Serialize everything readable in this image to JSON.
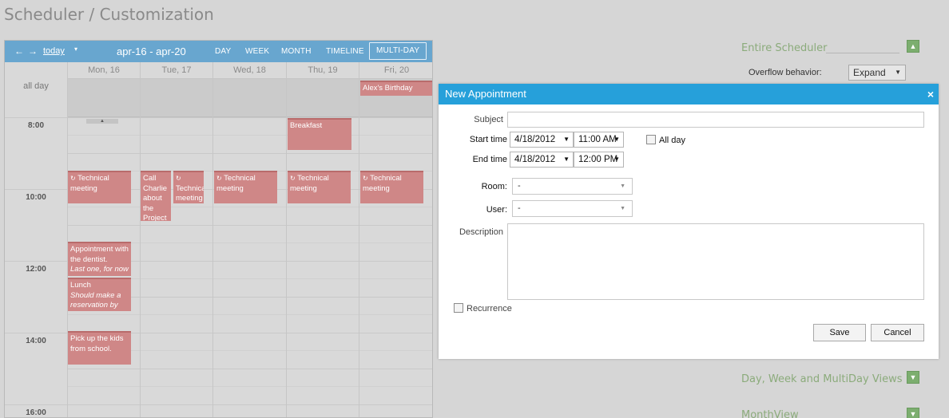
{
  "page": {
    "title": "Scheduler / Customization"
  },
  "toolbar": {
    "prev": "←",
    "next": "→",
    "today": "today",
    "today_caret": "▾",
    "range": "apr-16 - apr-20",
    "views": [
      "DAY",
      "WEEK",
      "MONTH",
      "TIMELINE",
      "MULTI-DAY"
    ],
    "active_view": "MULTI-DAY"
  },
  "days": [
    "Mon, 16",
    "Tue, 17",
    "Wed, 18",
    "Thu, 19",
    "Fri, 20"
  ],
  "allday_label": "all day",
  "times": [
    "8:00",
    "10:00",
    "12:00",
    "14:00",
    "16:00"
  ],
  "appointments": {
    "birthday": "Alex's Birthday",
    "breakfast": "Breakfast",
    "tech_mon": "Technical meeting",
    "call_charlie": "Call Charlie about the Project",
    "tech_tue": "Technical meeting",
    "tech_wed": "Technical meeting",
    "tech_thu": "Technical meeting",
    "tech_fri": "Technical meeting",
    "dentist_title": "Appointment with the dentist.",
    "dentist_note": "Last one, for now",
    "lunch_title": "Lunch",
    "lunch_note": "Should make a reservation by",
    "kids": "Pick up the kids from school."
  },
  "recurrence_glyph": "↻",
  "scroll_up_glyph": "▲",
  "settings": {
    "entire_scheduler": "Entire Scheduler",
    "overflow_label": "Overflow behavior:",
    "overflow_value": "Expand",
    "views_section": "Day, Week and MultiDay Views",
    "month_section": "MonthView",
    "expand_glyph": "▲",
    "collapse_glyph": "▼"
  },
  "dialog": {
    "title": "New Appointment",
    "close": "×",
    "subject_label": "Subject",
    "subject_value": "",
    "start_label": "Start time",
    "start_date": "4/18/2012",
    "start_time": "11:00 AM",
    "end_label": "End time",
    "end_date": "4/18/2012",
    "end_time": "12:00 PM",
    "all_day_label": "All day",
    "all_day_checked": false,
    "room_label": "Room:",
    "room_value": "-",
    "user_label": "User:",
    "user_value": "-",
    "description_label": "Description",
    "description_value": "",
    "recurrence_label": "Recurrence",
    "recurrence_checked": false,
    "save": "Save",
    "cancel": "Cancel"
  },
  "colors": {
    "toolbar": "#68a6cf",
    "appointment": "#cf8787",
    "dialog_title": "#26a0da",
    "section_head": "#8bab7b",
    "toggle": "#7cae6f"
  }
}
